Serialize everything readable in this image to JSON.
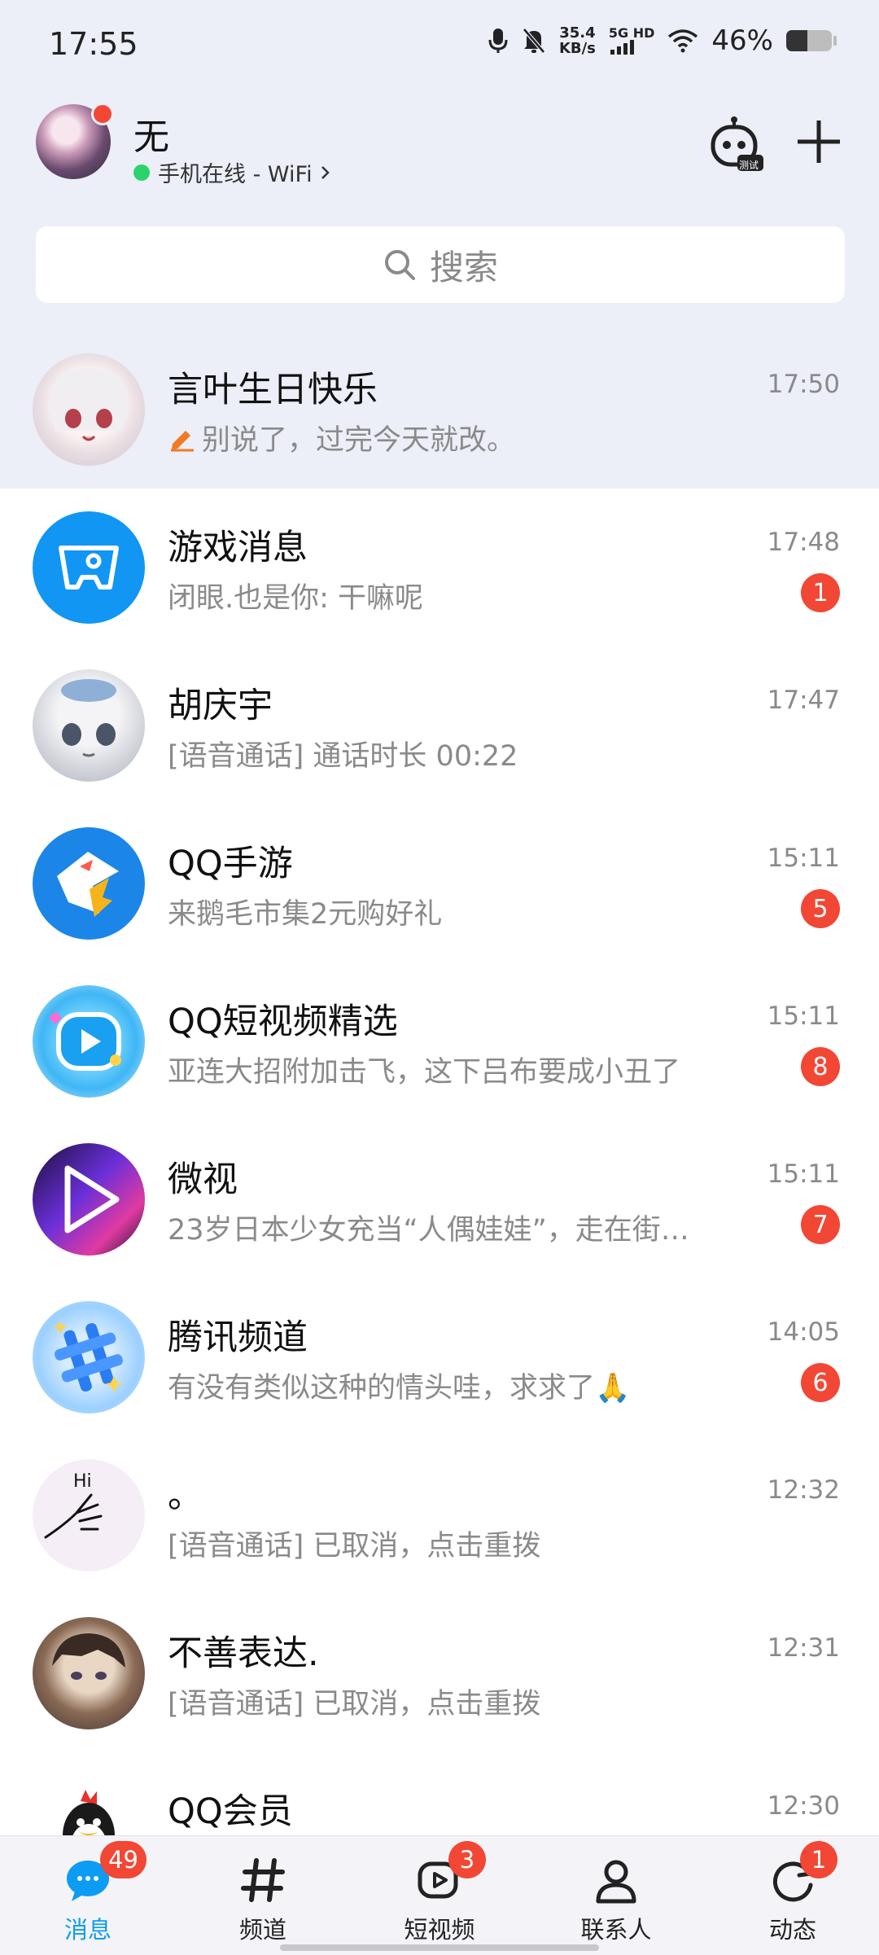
{
  "status_bar": {
    "time": "17:55",
    "net_speed_value": "35.4",
    "net_speed_unit": "KB/s",
    "network_type": "5G HD",
    "battery_percent": "46%",
    "battery_level": 0.46
  },
  "header": {
    "user_name": "无",
    "online_status": "手机在线 - WiFi",
    "robot_badge": "测试"
  },
  "search": {
    "placeholder": "搜索"
  },
  "conversations": [
    {
      "title": "言叶生日快乐",
      "preview": "别说了，过完今天就改。",
      "time": "17:50",
      "badge": "",
      "pinned": true,
      "draft_icon": "pencil-icon"
    },
    {
      "title": "游戏消息",
      "preview": "闭眼.也是你: 干嘛呢",
      "time": "17:48",
      "badge": "1"
    },
    {
      "title": "胡庆宇",
      "preview": "[语音通话] 通话时长 00:22",
      "time": "17:47",
      "badge": ""
    },
    {
      "title": "QQ手游",
      "preview": "来鹅毛市集2元购好礼",
      "time": "15:11",
      "badge": "5"
    },
    {
      "title": "QQ短视频精选",
      "preview": "亚连大招附加击飞，这下吕布要成小丑了",
      "time": "15:11",
      "badge": "8"
    },
    {
      "title": "微视",
      "preview": "23岁日本少女充当“人偶娃娃”，走在街…",
      "time": "15:11",
      "badge": "7"
    },
    {
      "title": "腾讯频道",
      "preview": "有没有类似这种的情头哇，求求了🙏",
      "time": "14:05",
      "badge": "6"
    },
    {
      "title": "。",
      "preview": "[语音通话] 已取消，点击重拨",
      "time": "12:32",
      "badge": ""
    },
    {
      "title": "不善表达.",
      "preview": "[语音通话] 已取消，点击重拨",
      "time": "12:31",
      "badge": ""
    },
    {
      "title": "QQ会员",
      "preview": "",
      "time": "12:30",
      "badge": ""
    }
  ],
  "bottom_nav": [
    {
      "label": "消息",
      "badge": "49",
      "active": true,
      "icon": "chat-bubble-icon"
    },
    {
      "label": "频道",
      "badge": "",
      "icon": "hash-icon"
    },
    {
      "label": "短视频",
      "badge": "3",
      "icon": "video-play-icon"
    },
    {
      "label": "联系人",
      "badge": "",
      "icon": "person-icon"
    },
    {
      "label": "动态",
      "badge": "1",
      "icon": "refresh-circle-icon"
    }
  ],
  "colors": {
    "accent_blue": "#0c9cf4",
    "badge_red": "#f24735",
    "online_green": "#2bd36b",
    "header_bg": "#eceef8"
  }
}
